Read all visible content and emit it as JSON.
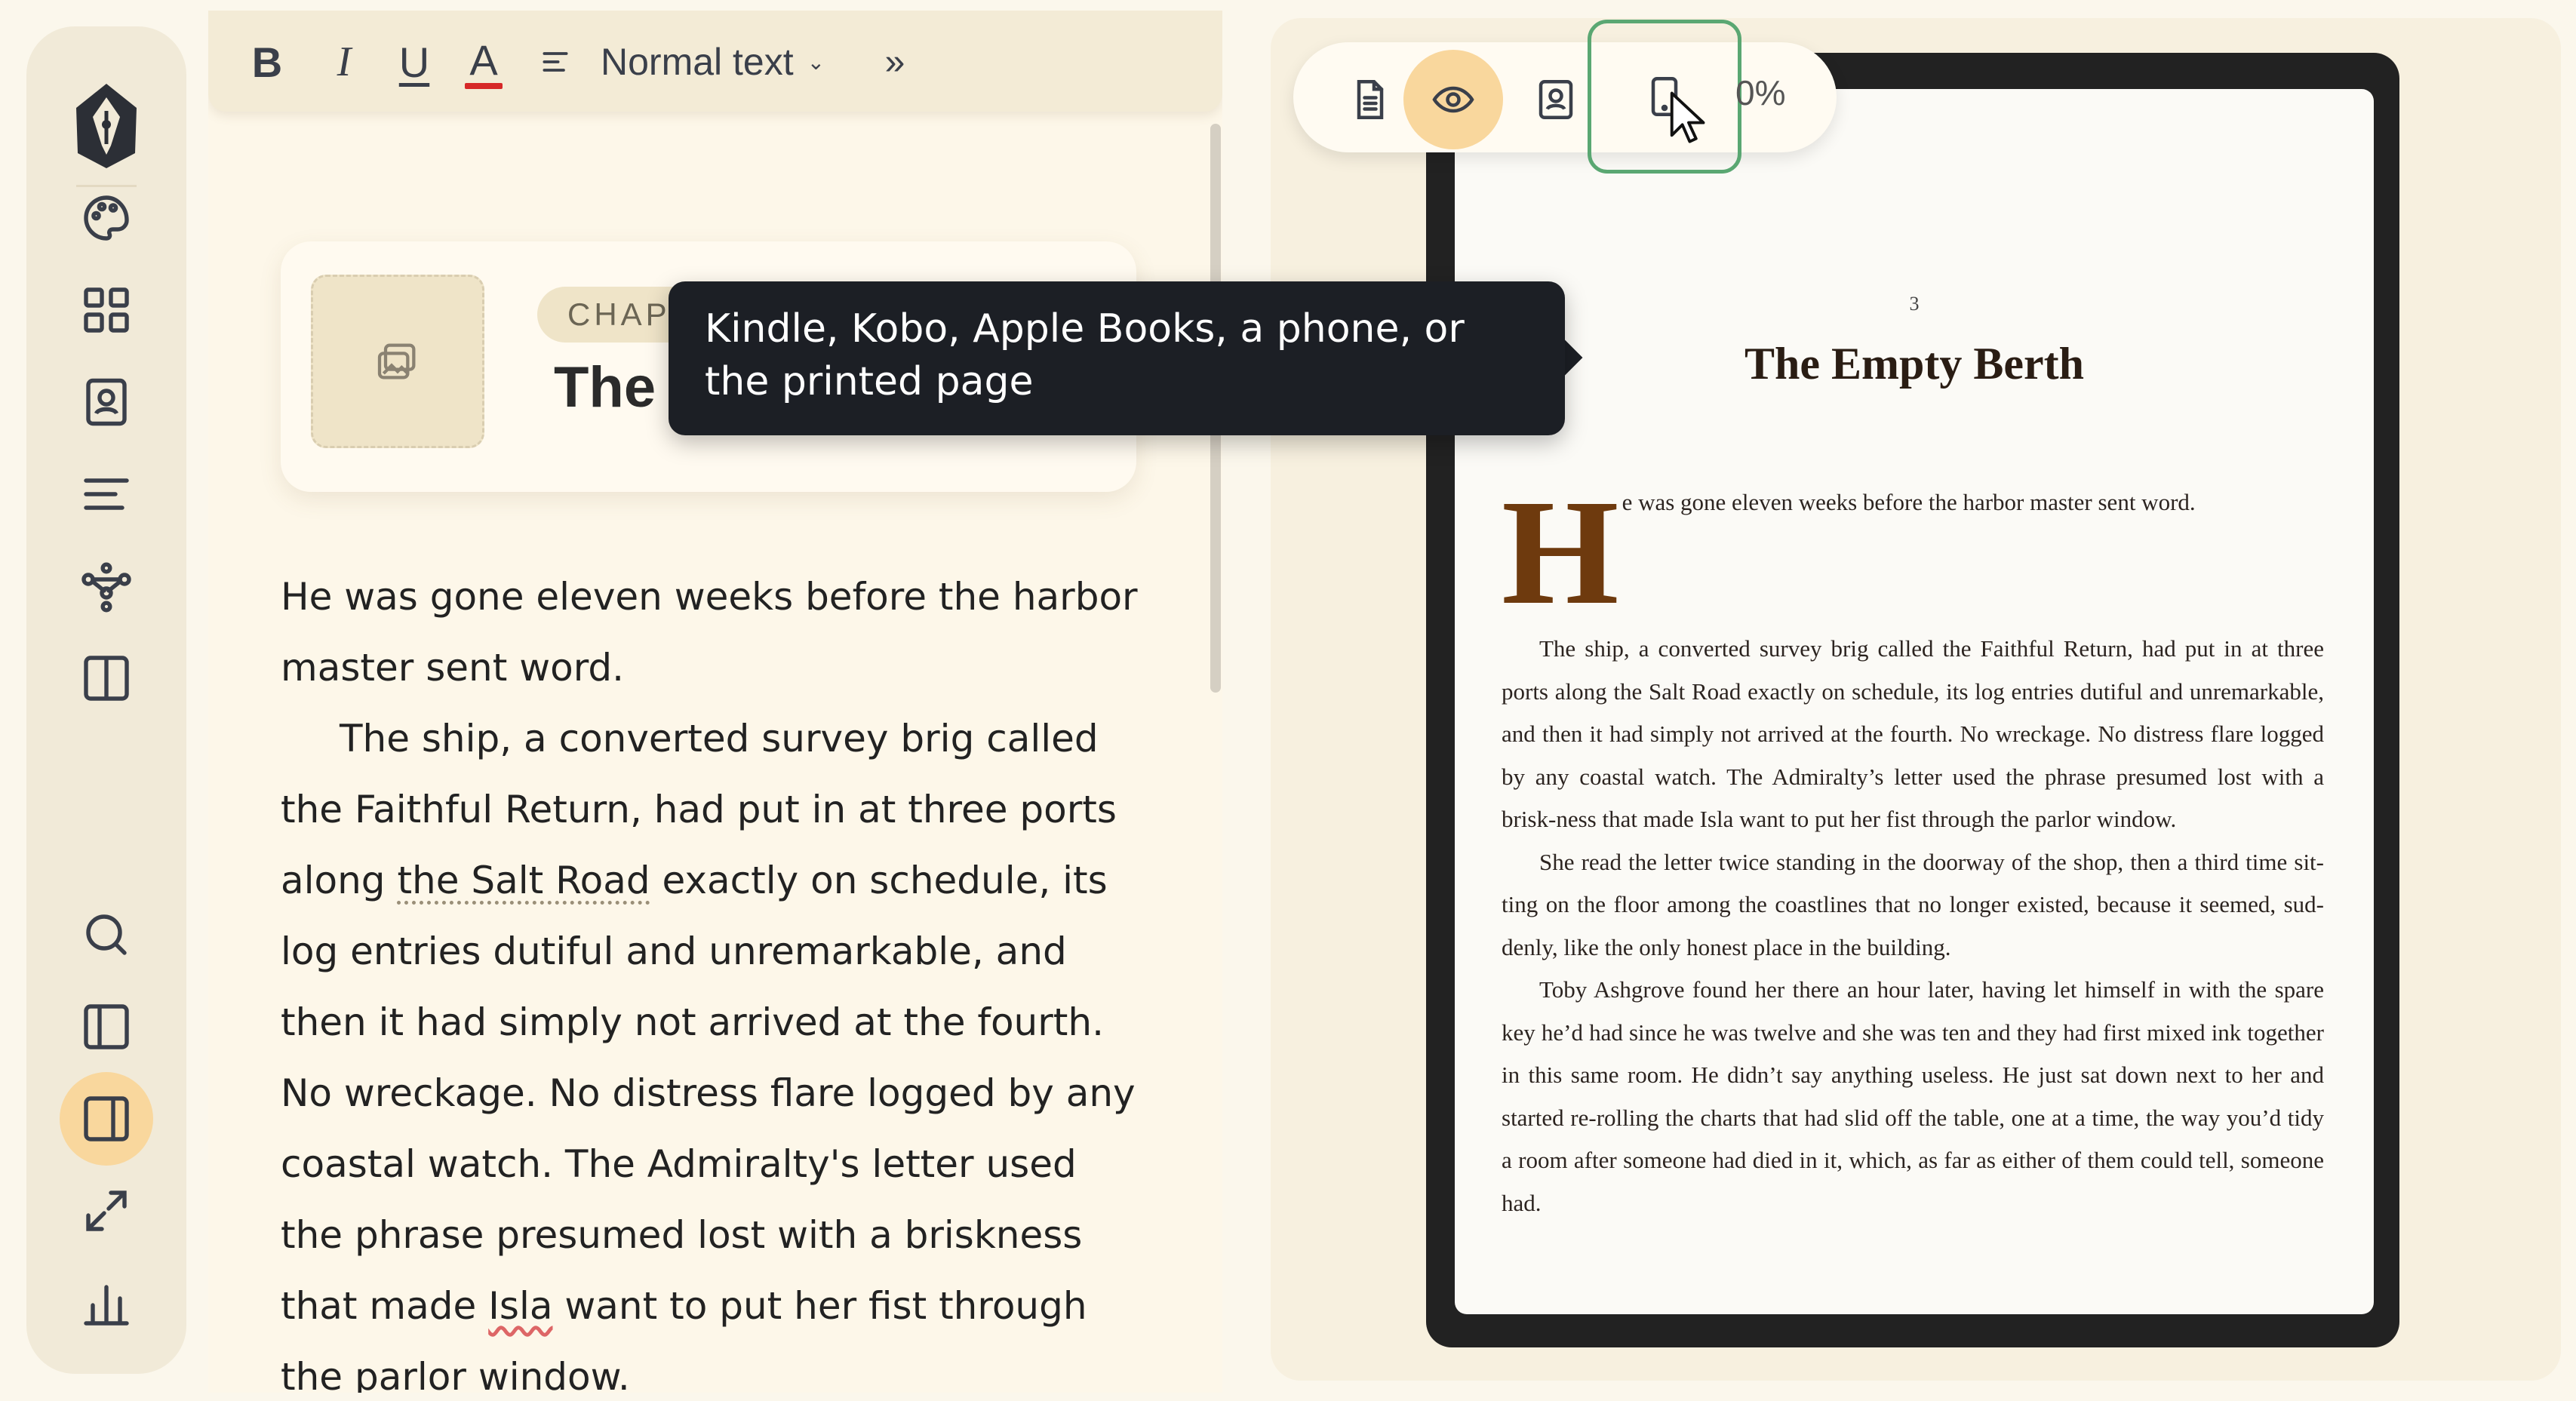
{
  "toolbar": {
    "bold": "B",
    "italic": "I",
    "underline": "U",
    "text_color": "A",
    "text_color_value": "#d62828",
    "style_select": "Normal text"
  },
  "chapter": {
    "tag": "CHAPTER",
    "title": "The Empty Berth"
  },
  "editor": {
    "paragraph1": "He was gone eleven weeks before the harbor master sent word.",
    "p2_part1": "The ship, a converted survey brig called the Faithful Return, had put in at three ports along ",
    "p2_link": "the Salt Road",
    "p2_part2": " exactly on schedule, its log entries dutiful and unremarkable, and then it had simply not arrived at the fourth. No wreckage. No distress flare logged by any coastal watch. The Admiralty's letter used the phrase presumed lost with a briskness that made ",
    "p2_name": "Isla",
    "p2_part3": " want to put her fist through the parlor window."
  },
  "preview": {
    "zoom": "0%",
    "page_number": "3",
    "page_title": "The Empty Berth",
    "dropcap": "H",
    "p1_rest": "e was gone eleven weeks before the harbor master sent word.",
    "p2": "The ship, a converted survey brig called the Faithful Return, had put in at three ports along the Salt Road exactly on schedule, its log entries dutiful and unremarkable, and then it had simply not arrived at the fourth. No wreckage. No distress flare logged by any coastal watch. The Admiralty’s letter used the phrase presumed lost with a brisk-ness that made Isla want to put her fist through the parlor window.",
    "p3": "She read the letter twice standing in the doorway of the shop, then a third time sit-ting on the floor among the coastlines that no longer existed, because it seemed, sud-denly, like the only honest place in the building.",
    "p4": "Toby Ashgrove found her there an hour later, having let himself in with the spare key he’d had since he was twelve and she was ten and they had first mixed ink together in this same room. He didn’t say anything useless. He just sat down next to her and started re-rolling the charts that had slid off the table, one at a time, the way you’d tidy a room after someone had died in it, which, as far as either of them could tell, someone had."
  },
  "tooltip": {
    "text": "Kindle, Kobo, Apple Books, a phone, or the printed page"
  },
  "colors": {
    "accent": "#f9d79d",
    "focus_ring": "#5aa772",
    "dropcap": "#6e3a0e"
  },
  "icons": {
    "rail": [
      "pen-nib-logo-icon",
      "palette-icon",
      "grid-icon",
      "contact-book-icon",
      "lines-icon",
      "workflow-icon",
      "columns-icon",
      "search-icon",
      "sidebar-icon",
      "split-view-icon",
      "expand-icon",
      "stats-icon"
    ],
    "preview_modes": [
      "document-icon",
      "eye-icon",
      "contact-book-icon",
      "phone-icon"
    ]
  }
}
